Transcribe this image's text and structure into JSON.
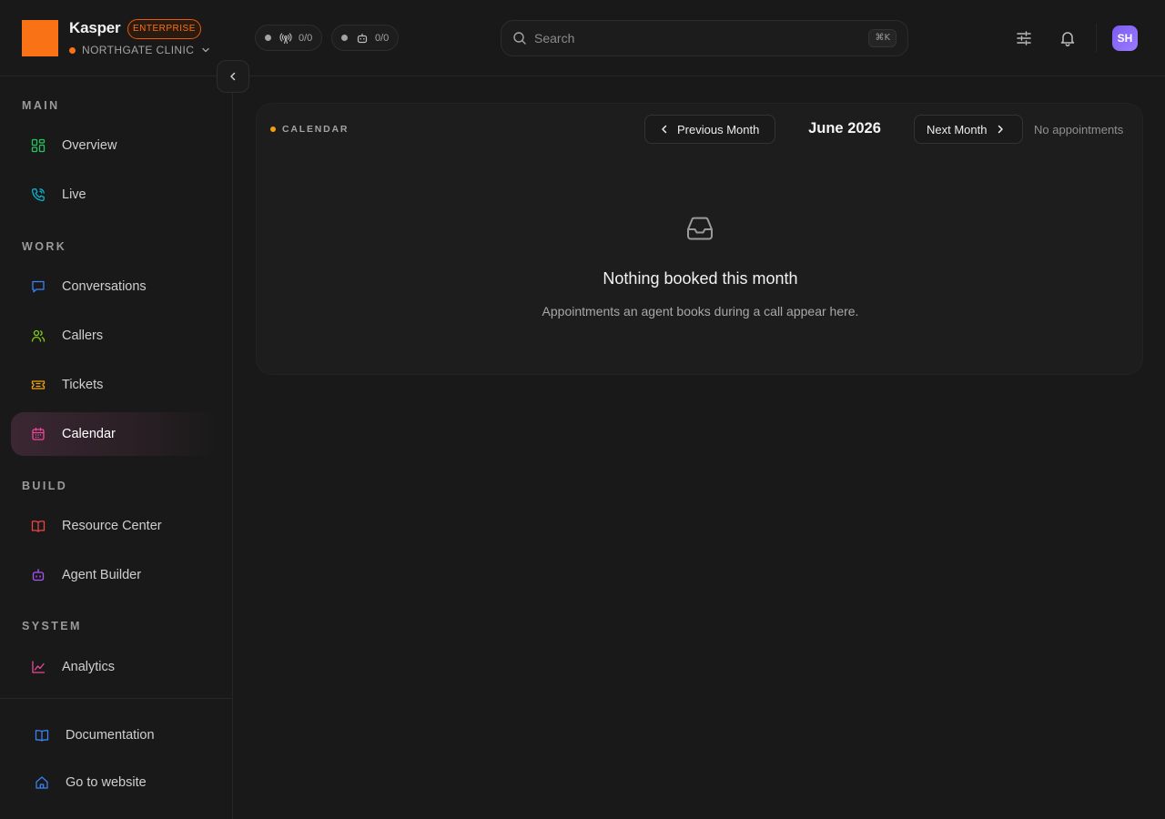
{
  "brand": {
    "name": "Kasper",
    "plan": "ENTERPRISE",
    "org": "NORTHGATE CLINIC"
  },
  "status": {
    "channels": {
      "icon": "broadcast-icon",
      "count": "0/0"
    },
    "agents": {
      "icon": "robot-icon",
      "count": "0/0"
    }
  },
  "search": {
    "placeholder": "Search",
    "shortcut": "⌘K"
  },
  "user": {
    "initials": "SH"
  },
  "sidebar": {
    "sections": [
      {
        "title": "MAIN",
        "items": [
          {
            "label": "Overview",
            "icon": "grid-icon",
            "color": "#22c55e"
          },
          {
            "label": "Live",
            "icon": "phone-icon",
            "color": "#06b6d4"
          }
        ]
      },
      {
        "title": "WORK",
        "items": [
          {
            "label": "Conversations",
            "icon": "chat-icon",
            "color": "#3b82f6"
          },
          {
            "label": "Callers",
            "icon": "users-icon",
            "color": "#84cc16"
          },
          {
            "label": "Tickets",
            "icon": "ticket-icon",
            "color": "#f59e0b"
          },
          {
            "label": "Calendar",
            "icon": "calendar-icon",
            "color": "#ec4899",
            "active": true
          }
        ]
      },
      {
        "title": "BUILD",
        "items": [
          {
            "label": "Resource Center",
            "icon": "book-icon",
            "color": "#ef4444"
          },
          {
            "label": "Agent Builder",
            "icon": "robot-icon",
            "color": "#a855f7"
          }
        ]
      },
      {
        "title": "SYSTEM",
        "items": [
          {
            "label": "Analytics",
            "icon": "chart-icon",
            "color": "#ec4899"
          }
        ]
      }
    ],
    "footer": [
      {
        "label": "Documentation",
        "icon": "book-open-icon",
        "color": "#3b82f6"
      },
      {
        "label": "Go to website",
        "icon": "home-icon",
        "color": "#3b82f6"
      }
    ]
  },
  "calendar": {
    "section_label": "CALENDAR",
    "prev_label": "Previous Month",
    "next_label": "Next Month",
    "month": "June 2026",
    "count_label": "No appointments",
    "empty_title": "Nothing booked this month",
    "empty_desc": "Appointments an agent books during a call appear here."
  }
}
